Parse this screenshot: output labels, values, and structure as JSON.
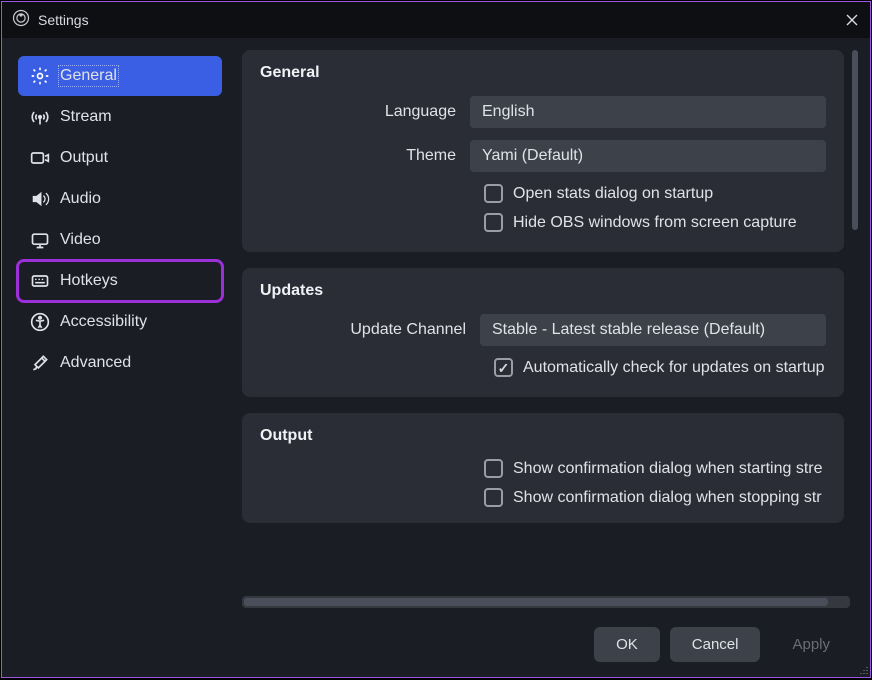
{
  "window": {
    "title": "Settings"
  },
  "sidebar": {
    "items": [
      {
        "label": "General"
      },
      {
        "label": "Stream"
      },
      {
        "label": "Output"
      },
      {
        "label": "Audio"
      },
      {
        "label": "Video"
      },
      {
        "label": "Hotkeys"
      },
      {
        "label": "Accessibility"
      },
      {
        "label": "Advanced"
      }
    ]
  },
  "panels": {
    "general": {
      "title": "General",
      "language_label": "Language",
      "language_value": "English",
      "theme_label": "Theme",
      "theme_value": "Yami (Default)",
      "open_stats_label": "Open stats dialog on startup",
      "hide_obs_label": "Hide OBS windows from screen capture"
    },
    "updates": {
      "title": "Updates",
      "channel_label": "Update Channel",
      "channel_value": "Stable - Latest stable release (Default)",
      "auto_check_label": "Automatically check for updates on startup"
    },
    "output": {
      "title": "Output",
      "confirm_start_label": "Show confirmation dialog when starting stre",
      "confirm_stop_label": "Show confirmation dialog when stopping str"
    }
  },
  "footer": {
    "ok": "OK",
    "cancel": "Cancel",
    "apply": "Apply"
  }
}
